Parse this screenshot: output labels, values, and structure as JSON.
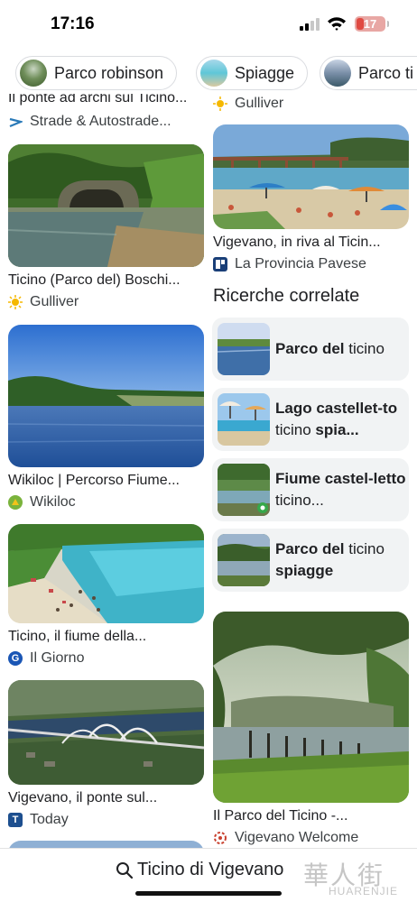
{
  "status": {
    "time": "17:16",
    "battery": "17"
  },
  "chips": [
    {
      "label": "Parco robinson"
    },
    {
      "label": "Spiagge"
    },
    {
      "label": "Parco ti"
    }
  ],
  "left": {
    "partial": {
      "title": "Il ponte ad archi sul Ticino...",
      "source": "Strade & Autostrade...",
      "icon": "strade-logo-icon"
    },
    "cards": [
      {
        "title": "Ticino (Parco del) Boschi...",
        "source": "Gulliver",
        "icon": "gulliver-sun-icon"
      },
      {
        "title": "Wikiloc | Percorso Fiume...",
        "source": "Wikiloc",
        "icon": "wikiloc-icon"
      },
      {
        "title": "Ticino, il fiume della...",
        "source": "Il Giorno",
        "icon": "il-giorno-icon"
      },
      {
        "title": "Vigevano, il ponte sul...",
        "source": "Today",
        "icon": "today-icon"
      }
    ]
  },
  "right": {
    "partial": {
      "source": "Gulliver",
      "icon": "gulliver-sun-icon"
    },
    "top_card": {
      "title": "Vigevano, in riva al Ticin...",
      "source": "La Provincia Pavese",
      "icon": "provincia-pavese-icon"
    },
    "related": {
      "heading": "Ricerche correlate",
      "items": [
        {
          "bold1": "Parco del",
          "normal": " ticino",
          "bold2": ""
        },
        {
          "bold1": "Lago castellet-to",
          "normal": " ticino ",
          "bold2": "spia..."
        },
        {
          "bold1": "Fiume castel-letto",
          "normal": " ticino...",
          "bold2": ""
        },
        {
          "bold1": "Parco del",
          "normal": " ticino ",
          "bold2": "spiagge"
        }
      ]
    },
    "bottom_card": {
      "title": "Il Parco del Ticino -...",
      "source": "Vigevano Welcome",
      "icon": "vigevano-welcome-icon"
    }
  },
  "bottom": {
    "query": "Ticino di Vigevano",
    "watermark_big": "華人街",
    "watermark_small": "HUARENJIE"
  },
  "colors": {
    "chip_border": "#dadce0",
    "related_bg": "#f1f3f4",
    "battery_low": "#e04a42"
  }
}
